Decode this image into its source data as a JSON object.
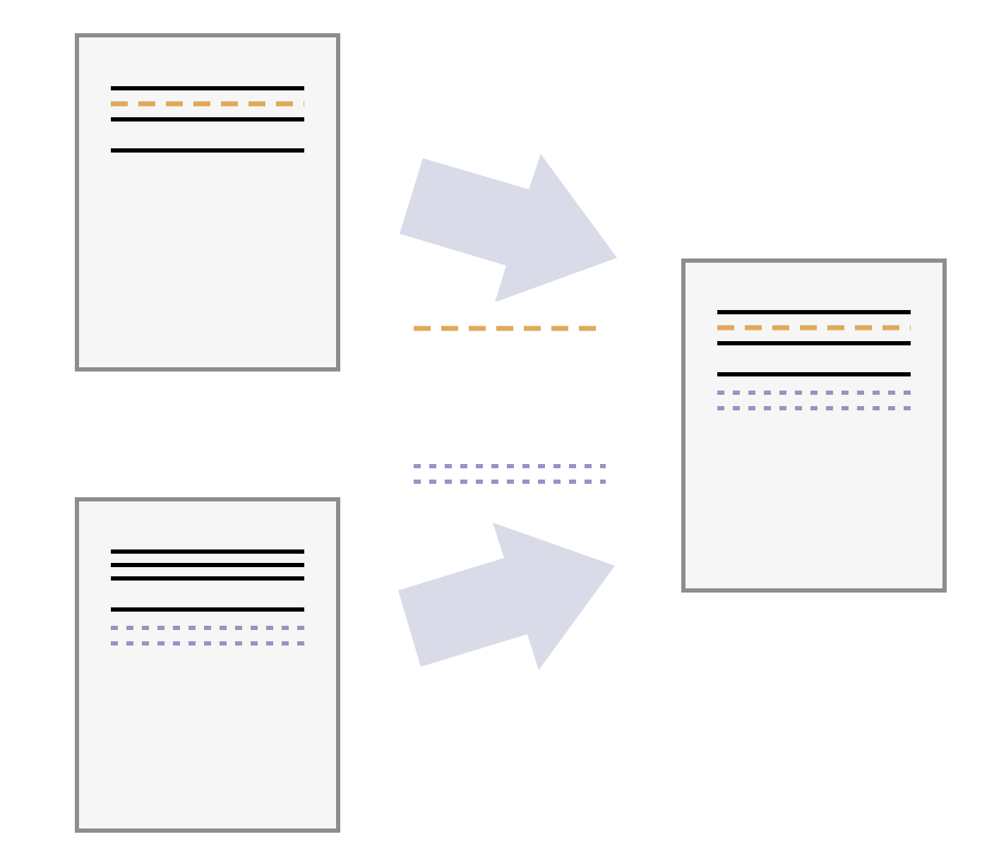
{
  "colors": {
    "background": "#ffffff",
    "document_fill": "#f6f6f6",
    "document_border": "#8b8d90",
    "solid_line": "#000000",
    "dashed_line": "#e0a95a",
    "dotted_line": "#9a91c4",
    "arrow_fill": "#d9dbe9"
  },
  "documents": {
    "source_a": {
      "lines": [
        "solid",
        "dashed",
        "solid",
        "gap",
        "solid"
      ]
    },
    "source_b": {
      "lines": [
        "solid",
        "solid",
        "solid",
        "gap",
        "solid",
        "dotted",
        "dotted"
      ]
    },
    "merged": {
      "lines": [
        "solid",
        "dashed",
        "solid",
        "gap",
        "solid",
        "dotted",
        "dotted"
      ]
    }
  },
  "transfers": {
    "from_a": [
      "dashed"
    ],
    "from_b": [
      "dotted",
      "dotted"
    ]
  },
  "icons": {
    "arrow_upper": "arrow-right-up-icon",
    "arrow_lower": "arrow-right-up-icon"
  }
}
